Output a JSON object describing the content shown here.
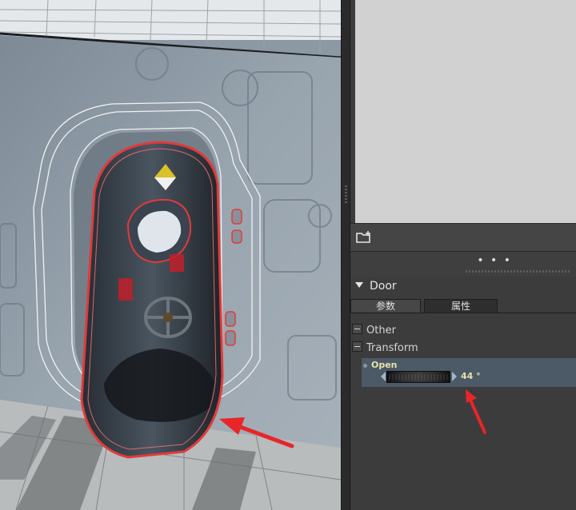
{
  "panel": {
    "section_title": "Door",
    "tabs": [
      {
        "label": "参数"
      },
      {
        "label": "属性"
      }
    ],
    "groups": [
      {
        "label": "Other"
      },
      {
        "label": "Transform"
      }
    ],
    "open_param": {
      "label": "Open",
      "value": "44 °"
    },
    "more_label": "• • •"
  },
  "colors": {
    "annotation_arrow": "#e8262a",
    "selection_outline": "#e23a3a",
    "param_row_bg": "#4c5966",
    "param_text": "#e8e2a8"
  },
  "icons": [
    "new-folder-icon",
    "collapse-triangle-icon",
    "collapse-box-icon",
    "slider-left-arrow-icon",
    "slider-right-arrow-icon",
    "annotation-arrow"
  ]
}
